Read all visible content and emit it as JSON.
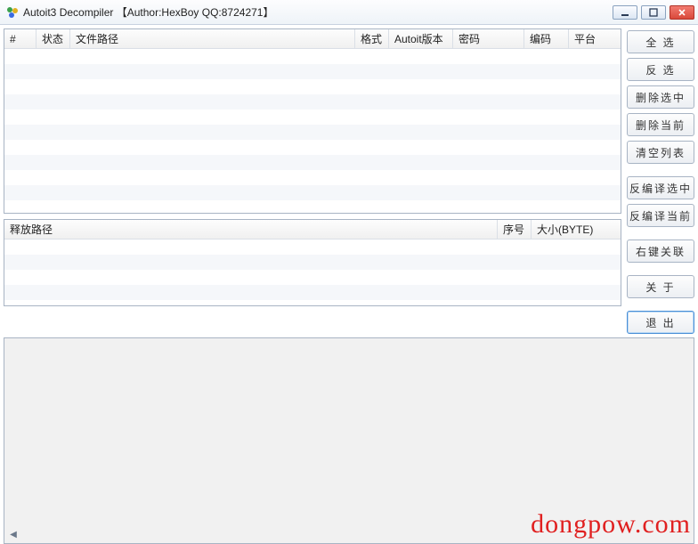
{
  "window": {
    "title": "Autoit3 Decompiler  【Author:HexBoy  QQ:8724271】"
  },
  "top_table": {
    "columns": {
      "num": "#",
      "status": "状态",
      "filepath": "文件路径",
      "format": "格式",
      "autoit_ver": "Autoit版本",
      "password": "密码",
      "encoding": "编码",
      "platform": "平台"
    },
    "rows": []
  },
  "mid_table": {
    "columns": {
      "release_path": "释放路径",
      "seq": "序号",
      "size_byte": "大小(BYTE)"
    },
    "rows": []
  },
  "buttons": {
    "select_all": "全 选",
    "invert": "反 选",
    "delete_selected": "删除选中",
    "delete_current": "删除当前",
    "clear_list": "清空列表",
    "decompile_selected": "反编译选中",
    "decompile_current": "反编译当前",
    "rclick_assoc": "右键关联",
    "about": "关 于",
    "exit": "退 出"
  },
  "watermark": "dongpow.com"
}
